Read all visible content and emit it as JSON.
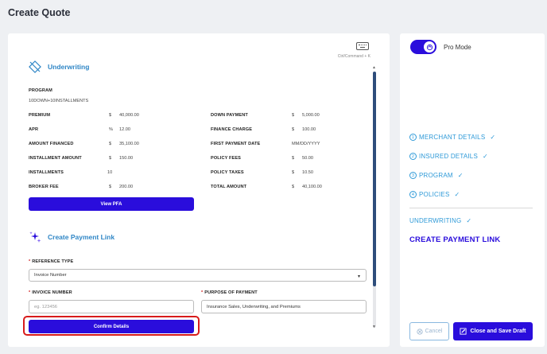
{
  "page": {
    "title": "Create Quote"
  },
  "main": {
    "shortcut_hint": "Ctrl/Command + K",
    "underwriting": {
      "title": "Underwriting",
      "program_label": "PROGRAM",
      "program_value": "10DOWN+10INSTALLMENTS",
      "fields": {
        "premium": {
          "label": "PREMIUM",
          "currency": "$",
          "value": "40,000.00"
        },
        "down_payment": {
          "label": "DOWN PAYMENT",
          "currency": "$",
          "value": "5,000.00"
        },
        "apr": {
          "label": "APR",
          "currency": "%",
          "value": "12.00"
        },
        "finance_charge": {
          "label": "FINANCE CHARGE",
          "currency": "$",
          "value": "100.00"
        },
        "amount_financed": {
          "label": "AMOUNT FINANCED",
          "currency": "$",
          "value": "35,100.00"
        },
        "first_payment_date": {
          "label": "FIRST PAYMENT DATE",
          "value": "MM/DD/YYYY"
        },
        "installment_amount": {
          "label": "INSTALLMENT AMOUNT",
          "currency": "$",
          "value": "150.00"
        },
        "policy_fees": {
          "label": "POLICY FEES",
          "currency": "$",
          "value": "50.00"
        },
        "installments": {
          "label": "INSTALLMENTS",
          "value": "10"
        },
        "policy_taxes": {
          "label": "POLICY TAXES",
          "currency": "$",
          "value": "10.50"
        },
        "broker_fee": {
          "label": "BROKER FEE",
          "currency": "$",
          "value": "200.00"
        },
        "total_amount": {
          "label": "TOTAL AMOUNT",
          "currency": "$",
          "value": "40,100.00"
        }
      },
      "view_pfa_label": "View PFA"
    },
    "payment_link": {
      "title": "Create Payment Link",
      "reference_type": {
        "label": "REFERENCE TYPE",
        "value": "Invoice Number"
      },
      "invoice_number": {
        "label": "INVOICE NUMBER",
        "placeholder": "eg. 123456"
      },
      "purpose": {
        "label": "PURPOSE OF PAYMENT",
        "value": "Insurance Sales, Underwriting, and Premiums"
      },
      "required_mark": "*",
      "confirm_label": "Confirm Details"
    }
  },
  "sidebar": {
    "pro_mode_label": "Pro Mode",
    "steps": [
      {
        "num": "1",
        "label": "MERCHANT DETAILS"
      },
      {
        "num": "2",
        "label": "INSURED DETAILS"
      },
      {
        "num": "3",
        "label": "PROGRAM"
      },
      {
        "num": "4",
        "label": "POLICIES"
      }
    ],
    "underwriting_step": "UNDERWRITING",
    "current_step": "CREATE PAYMENT LINK",
    "cancel_label": "Cancel",
    "save_label": "Close and Save Draft"
  },
  "colors": {
    "accent": "#2a0ddc",
    "link": "#2f9ad8",
    "highlight": "#d81b1b"
  }
}
